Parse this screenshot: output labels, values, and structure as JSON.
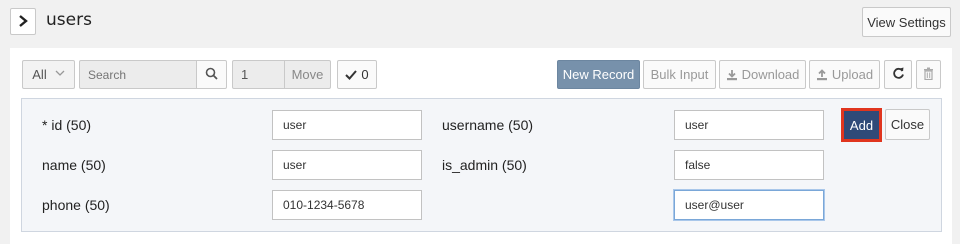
{
  "header": {
    "title": "users",
    "view_settings_label": "View Settings"
  },
  "toolbar": {
    "filter_select_value": "All",
    "search_placeholder": "Search",
    "page_value": "1",
    "move_label": "Move",
    "selected_count": "0",
    "new_record_label": "New Record",
    "bulk_input_label": "Bulk Input",
    "download_label": "Download",
    "upload_label": "Upload"
  },
  "form": {
    "fields": [
      {
        "label": "* id (50)",
        "value": "user"
      },
      {
        "label": "username (50)",
        "value": "user"
      },
      {
        "label": "name (50)",
        "value": "user"
      },
      {
        "label": "is_admin (50)",
        "value": "false"
      },
      {
        "label": "phone (50)",
        "value": "010-1234-5678"
      },
      {
        "label": "",
        "value": "user@user"
      }
    ],
    "add_label": "Add",
    "close_label": "Close"
  },
  "colors": {
    "accent_primary": "#2f4a78",
    "new_record_bg": "#7791ab",
    "highlight_border": "#e0351e"
  }
}
